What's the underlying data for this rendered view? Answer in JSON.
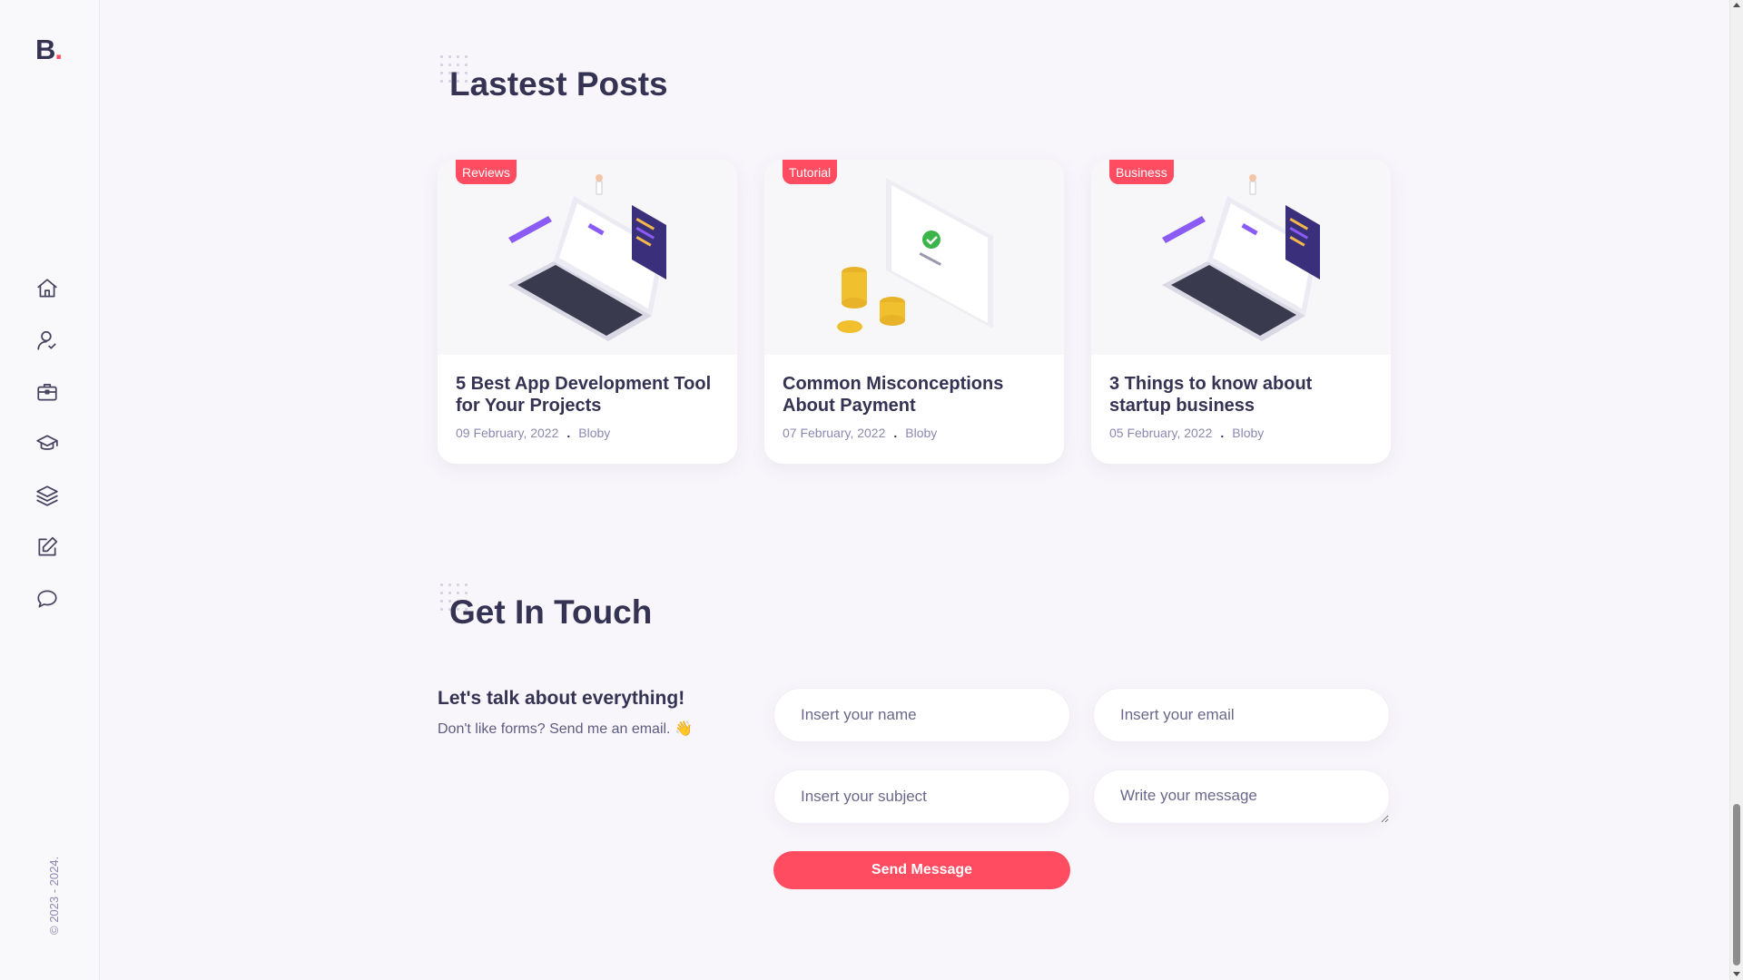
{
  "brand": {
    "logo_letter": "B",
    "logo_dot": "."
  },
  "sidebar": {
    "items": [
      {
        "icon": "home-icon"
      },
      {
        "icon": "user-icon"
      },
      {
        "icon": "briefcase-icon"
      },
      {
        "icon": "graduation-cap-icon"
      },
      {
        "icon": "layers-icon"
      },
      {
        "icon": "edit-icon"
      },
      {
        "icon": "chat-icon"
      }
    ],
    "copyright": "© 2023 - 2024."
  },
  "posts": {
    "title": "Lastest Posts",
    "items": [
      {
        "category": "Reviews",
        "title": "5 Best App Development Tool for Your Projects",
        "date": "09 February, 2022",
        "author": "Bloby",
        "image": "laptop-illustration"
      },
      {
        "category": "Tutorial",
        "title": "Common Misconceptions About Payment",
        "date": "07 February, 2022",
        "author": "Bloby",
        "image": "payment-illustration"
      },
      {
        "category": "Business",
        "title": "3 Things to know about startup business",
        "date": "05 February, 2022",
        "author": "Bloby",
        "image": "laptop-illustration"
      }
    ],
    "meta_separator": "."
  },
  "contact": {
    "title": "Get In Touch",
    "heading": "Let's talk about everything!",
    "subtext": "Don't like forms? Send me an email. 👋",
    "name_placeholder": "Insert your name",
    "email_placeholder": "Insert your email",
    "subject_placeholder": "Insert your subject",
    "message_placeholder": "Write your message",
    "send_label": "Send Message"
  },
  "colors": {
    "accent": "#ff4c60",
    "text": "#353353",
    "muted": "#8b88b1",
    "background": "#f8f6fb"
  }
}
